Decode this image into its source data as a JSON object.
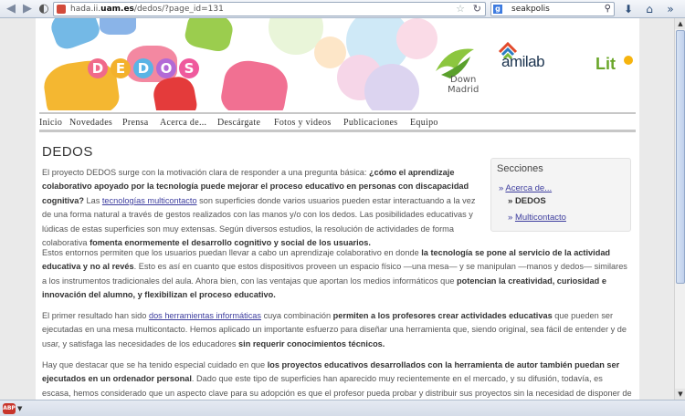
{
  "browser": {
    "url_prefix": "hada.ii.",
    "url_domain": "uam.es",
    "url_path": "/dedos/?page_id=131",
    "search_engine_label": "g",
    "search_query": "seakpolis",
    "icons": {
      "back": "back-arrow-icon",
      "forward": "forward-arrow-icon",
      "bookmark": "star-icon",
      "reload": "reload-icon",
      "search": "magnifier-icon",
      "download": "download-icon",
      "home": "home-icon",
      "menu": "menu-icon"
    }
  },
  "banner": {
    "dedos_letters": [
      "D",
      "E",
      "D",
      "O",
      "S"
    ],
    "dedos_colors": [
      "#f06a8a",
      "#f3b12c",
      "#5ab4e5",
      "#b26ad6",
      "#ef5a9d"
    ],
    "downmadrid_line1": "Down",
    "downmadrid_line2": "Madrid",
    "amilab": "amilab",
    "lite": "Lit"
  },
  "menu": {
    "items": [
      "Inicio",
      "Novedades",
      "Prensa",
      "Acerca de...",
      "Descárgate",
      "Fotos y videos",
      "Publicaciones",
      "Equipo"
    ]
  },
  "page": {
    "title": "DEDOS"
  },
  "sidebar": {
    "title": "Secciones",
    "items": [
      {
        "marker": "»",
        "label": "Acerca de..."
      },
      {
        "marker": "»",
        "label": "DEDOS"
      },
      {
        "marker": "»",
        "label": "Multicontacto"
      }
    ]
  },
  "content": {
    "p1": {
      "t1": "El proyecto DEDOS surge con la motivación clara de responder a una pregunta básica: ",
      "b1": "¿cómo el aprendizaje colaborativo apoyado por la tecnología puede mejorar el proceso educativo en personas con discapacidad cognitiva?",
      "t2": " Las ",
      "a1": "tecnologías multicontacto",
      "t3": " son superficies donde varios usuarios pueden estar interactuando a la vez de una forma natural a través de gestos realizados con las manos y/o con los dedos. Las posibilidades educativas y lúdicas de estas superficies son muy extensas. Según diversos estudios, la resolución de actividades de forma colaborativa ",
      "b2": "fomenta enormemente el desarrollo cognitivo y social de los usuarios."
    },
    "p1b": {
      "t1": "Estos entornos permiten que los usuarios puedan llevar a cabo un aprendizaje colaborativo en donde ",
      "b1": "la tecnología se pone al servicio de la actividad educativa y no al revés",
      "t2": ". Esto es así en cuanto que estos dispositivos proveen un espacio físico —una mesa— y se manipulan —manos y dedos— similares a los instrumentos tradicionales del aula. Ahora bien, con las ventajas que aportan los medios informáticos que ",
      "b2": "potencian la creatividad, curiosidad e innovación del alumno, y flexibilizan el proceso educativo."
    },
    "p2": {
      "t1": "El primer resultado han sido ",
      "a1": "dos herramientas informáticas",
      "t2": " cuya combinación ",
      "b1": "permiten a los profesores crear actividades educativas",
      "t3": " que pueden ser ejecutadas en una mesa multicontacto. Hemos aplicado un importante esfuerzo para diseñar una herramienta que, siendo  original, sea fácil de entender y de usar, y satisfaga las necesidades de los educadores ",
      "b2": "sin requerir conocimientos técnicos."
    },
    "p3": {
      "t1": "Hay que destacar que se ha tenido especial cuidado en que ",
      "b1": "los proyectos educativos desarrollados con la herramienta de autor también puedan ser ejecutados en un ordenador personal",
      "t2": ".  Dado que este tipo de superficies han aparecido muy recientemente en el mercado, y su difusión, todavía, es escasa, hemos considerado que un aspecto clave para su adopción es que el profesor pueda probar y distribuir sus proyectos sin la necesidad de disponer de una mesa multicontacto."
    }
  },
  "statusbar": {
    "addon_label": "ABP",
    "addon_icon": "adblock-icon"
  }
}
